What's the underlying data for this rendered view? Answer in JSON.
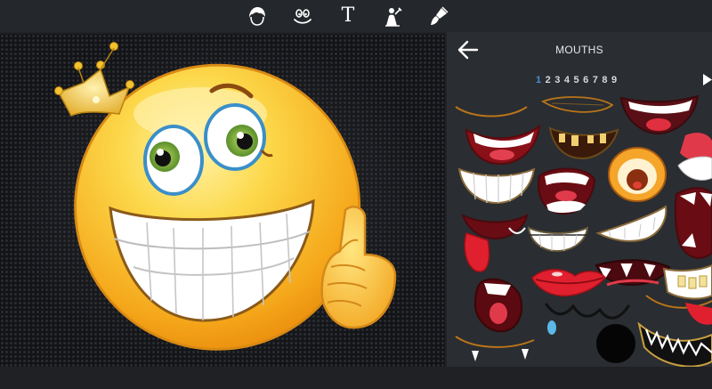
{
  "toolbar": {
    "tools": [
      {
        "name": "hair-tool",
        "icon": "hair-icon"
      },
      {
        "name": "face-tool",
        "icon": "smiley-face-icon"
      },
      {
        "name": "text-tool",
        "icon": "text-icon",
        "glyph": "T"
      },
      {
        "name": "figure-tool",
        "icon": "figure-icon"
      },
      {
        "name": "paint-tool",
        "icon": "paintbrush-icon"
      }
    ]
  },
  "panel": {
    "title": "MOUTHS",
    "back_icon": "back-arrow-icon",
    "pages": [
      "1",
      "2",
      "3",
      "4",
      "5",
      "6",
      "7",
      "8",
      "9"
    ],
    "active_page": "1",
    "next_icon": "play-triangle-icon"
  },
  "colors": {
    "toolbar_bg": "#24272b",
    "panel_bg": "#2a2d31",
    "accent_blue": "#4a90d9",
    "smiley_yellow": "#fcc419"
  }
}
